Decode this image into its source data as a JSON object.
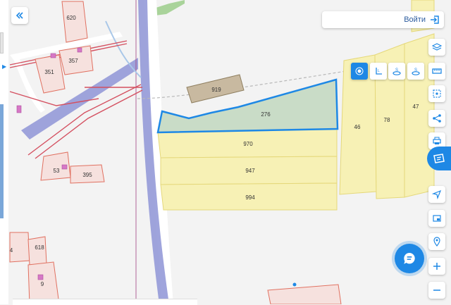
{
  "ui": {
    "login_label": "Войти",
    "accent_color": "#1e88e5",
    "selected_parcel_fill": "#c9dcc7",
    "selected_parcel_stroke": "#1e88e5",
    "parcel_fill": "#f7f1b5",
    "parcel_stroke": "#e5d87a",
    "building_fill": "#c8b9a0"
  },
  "parcels": {
    "p276": "276",
    "p919": "919",
    "p970": "970",
    "p947": "947",
    "p994": "994",
    "p46": "46",
    "p78": "78",
    "p47": "47",
    "p620": "620",
    "p357": "357",
    "p351": "351",
    "p53": "53",
    "p395": "395",
    "p618": "618",
    "p4": "4",
    "p9": "9"
  },
  "toolbar": {
    "tools": [
      "point",
      "line-measure",
      "area-measure",
      "area-measure-alt",
      "ruler"
    ]
  },
  "right_controls": [
    "layers-icon",
    "select-area-icon",
    "share-icon",
    "print-icon",
    "locate-icon",
    "minimap-icon",
    "geotag-icon",
    "zoom-in-icon",
    "zoom-out-icon"
  ]
}
